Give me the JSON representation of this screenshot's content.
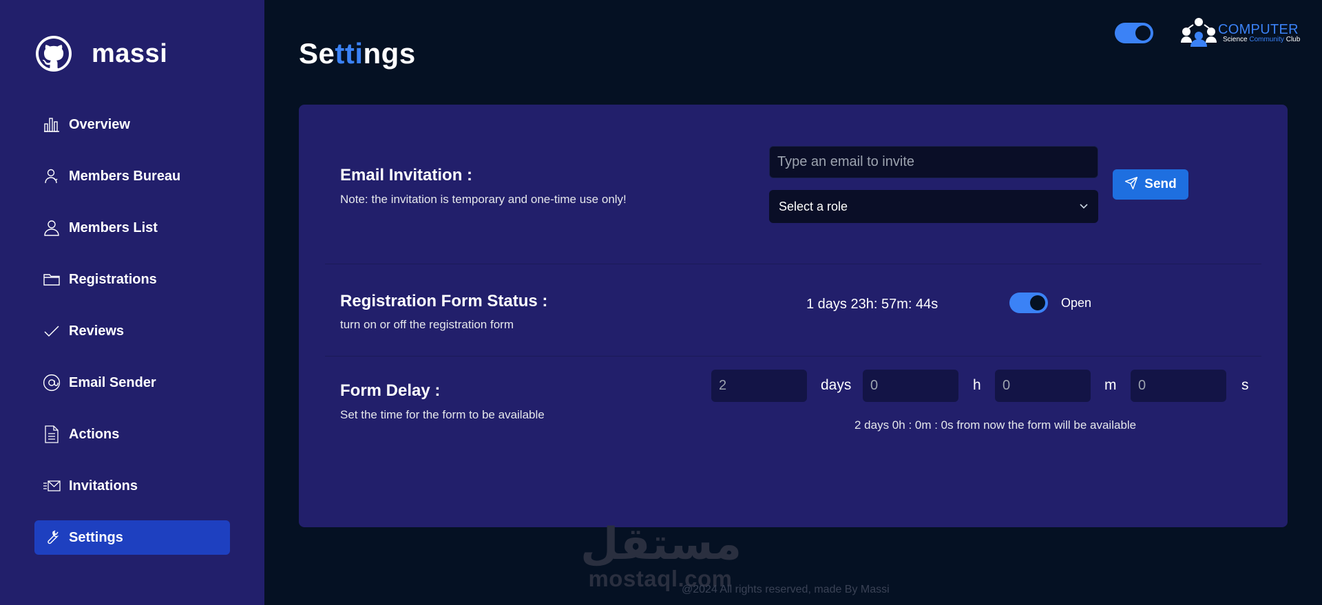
{
  "brand": {
    "name": "massi",
    "logo_icon": "github-icon"
  },
  "sidebar": {
    "items": [
      {
        "label": "Overview",
        "icon": "bar-chart-icon"
      },
      {
        "label": "Members Bureau",
        "icon": "user-badge-icon"
      },
      {
        "label": "Members List",
        "icon": "user-icon"
      },
      {
        "label": "Registrations",
        "icon": "folder-icon"
      },
      {
        "label": "Reviews",
        "icon": "check-icon"
      },
      {
        "label": "Email Sender",
        "icon": "at-sign-icon"
      },
      {
        "label": "Actions",
        "icon": "document-icon"
      },
      {
        "label": "Invitations",
        "icon": "mail-icon"
      },
      {
        "label": "Settings",
        "icon": "wrench-icon",
        "active": true
      }
    ]
  },
  "header": {
    "title_parts": [
      "Se",
      "tti",
      "ngs"
    ],
    "theme_toggle": {
      "on": true
    },
    "club_logo": {
      "line1": "COMPUTER",
      "line2_a": "Science ",
      "line2_b": "Community",
      "line2_c": " Club"
    }
  },
  "settings": {
    "email_invitation": {
      "title": "Email Invitation :",
      "note": "Note: the invitation is temporary and one-time use only!",
      "email_placeholder": "Type an email to invite",
      "role_select": "Select a role",
      "send_label": "Send"
    },
    "registration_status": {
      "title": "Registration Form Status :",
      "desc": "turn on or off the registration form",
      "countdown": "1 days 23h: 57m: 44s",
      "toggle_on": true,
      "state_label": "Open"
    },
    "form_delay": {
      "title": "Form Delay :",
      "desc": "Set the time for the form to be available",
      "days_value": "2",
      "hours_value": "0",
      "minutes_value": "0",
      "seconds_value": "0",
      "unit_days": "days",
      "unit_h": "h",
      "unit_m": "m",
      "unit_s": "s",
      "summary": "2 days 0h : 0m : 0s from now the form will be available"
    }
  },
  "watermark": {
    "arabic": "مستقل",
    "latin": "mostaql.com"
  },
  "footer": {
    "text": "@2024 All rights reserved, made By Massi"
  },
  "colors": {
    "sidebar_bg": "#221f6b",
    "page_bg": "#051123",
    "accent": "#3b82f6",
    "active_nav": "#1e40c0",
    "input_bg": "#0a0e27"
  }
}
